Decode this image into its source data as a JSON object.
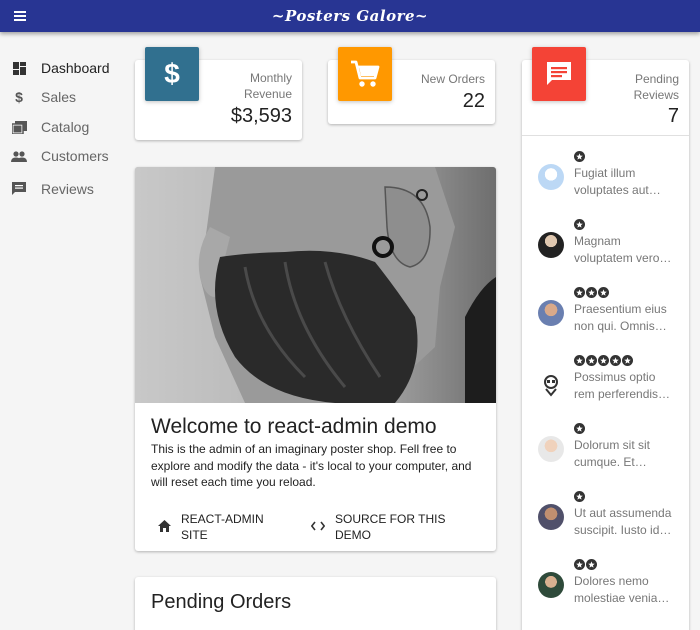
{
  "app": {
    "title": "~Posters Galore~"
  },
  "sidebar": {
    "items": [
      {
        "label": "Dashboard",
        "icon": "dashboard-icon"
      },
      {
        "label": "Sales",
        "icon": "dollar-icon"
      },
      {
        "label": "Catalog",
        "icon": "collections-icon"
      },
      {
        "label": "Customers",
        "icon": "people-icon"
      },
      {
        "label": "Reviews",
        "icon": "comment-icon"
      }
    ]
  },
  "stats": {
    "revenue": {
      "label_line1": "Monthly",
      "label_line2": "Revenue",
      "value": "$3,593",
      "color": "#31708f",
      "icon": "dollar-icon"
    },
    "orders": {
      "label": "New Orders",
      "value": "22",
      "color": "#ff9800",
      "icon": "shopping-cart-icon"
    },
    "reviews": {
      "label_line1": "Pending",
      "label_line2": "Reviews",
      "value": "7",
      "color": "#f44336",
      "icon": "comment-icon"
    }
  },
  "welcome": {
    "title": "Welcome to react-admin demo",
    "body": "This is the admin of an imaginary poster shop. Fell free to explore and modify the data - it's local to your computer, and will reset each time you reload.",
    "site_link": "React-admin site",
    "source_link": "Source for this demo"
  },
  "pending_orders": {
    "title": "Pending Orders"
  },
  "reviews": [
    {
      "stars": 1,
      "line1": "Fugiat illum",
      "line2": "voluptates aut…"
    },
    {
      "stars": 1,
      "line1": "Magnam",
      "line2": "voluptatem vero…"
    },
    {
      "stars": 3,
      "line1": "Praesentium eius",
      "line2": "non qui. Omnis…"
    },
    {
      "stars": 5,
      "line1": "Possimus optio",
      "line2": "rem perferendis…"
    },
    {
      "stars": 1,
      "line1": "Dolorum sit sit",
      "line2": "cumque. Et…"
    },
    {
      "stars": 1,
      "line1": "Ut aut assumenda",
      "line2": "suscipit. Iusto id…"
    },
    {
      "stars": 2,
      "line1": "Dolores nemo",
      "line2": "molestiae venia…"
    }
  ]
}
